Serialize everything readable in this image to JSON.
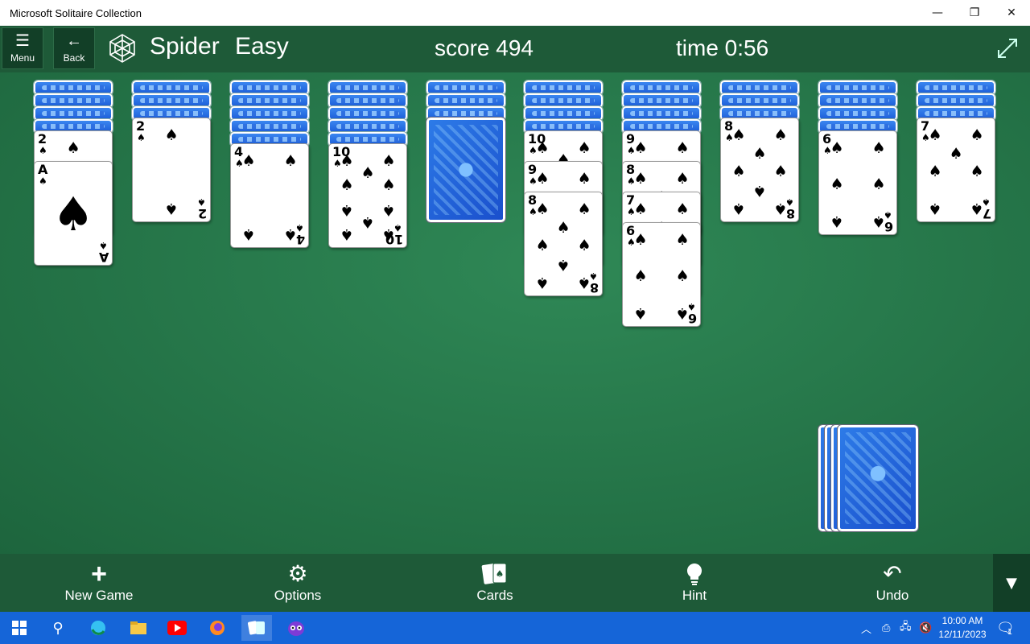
{
  "window": {
    "title": "Microsoft Solitaire Collection",
    "minimize": "—",
    "restore": "❐",
    "close": "✕"
  },
  "header": {
    "menu_label": "Menu",
    "back_label": "Back",
    "game_name": "Spider",
    "game_level": "Easy",
    "score_text": "score  494",
    "time_text": "time  0:56"
  },
  "tableau": [
    {
      "face_down": 4,
      "face_up": [
        {
          "rank": "2",
          "suit": "♠"
        },
        {
          "rank": "A",
          "suit": "♠"
        }
      ]
    },
    {
      "face_down": 3,
      "face_up": [
        {
          "rank": "2",
          "suit": "♠"
        }
      ]
    },
    {
      "face_down": 5,
      "face_up": [
        {
          "rank": "4",
          "suit": "♠"
        }
      ]
    },
    {
      "face_down": 5,
      "face_up": [
        {
          "rank": "10",
          "suit": "♠"
        }
      ]
    },
    {
      "face_down": 3,
      "face_up": [],
      "full_back": true
    },
    {
      "face_down": 4,
      "face_up": [
        {
          "rank": "10",
          "suit": "♠"
        },
        {
          "rank": "9",
          "suit": "♠"
        },
        {
          "rank": "8",
          "suit": "♠"
        }
      ]
    },
    {
      "face_down": 4,
      "face_up": [
        {
          "rank": "9",
          "suit": "♠"
        },
        {
          "rank": "8",
          "suit": "♠"
        },
        {
          "rank": "7",
          "suit": "♠"
        },
        {
          "rank": "6",
          "suit": "♠"
        }
      ]
    },
    {
      "face_down": 3,
      "face_up": [
        {
          "rank": "8",
          "suit": "♠"
        }
      ]
    },
    {
      "face_down": 4,
      "face_up": [
        {
          "rank": "6",
          "suit": "♠"
        }
      ]
    },
    {
      "face_down": 3,
      "face_up": [
        {
          "rank": "7",
          "suit": "♠"
        }
      ]
    }
  ],
  "stock": {
    "piles_remaining": 4
  },
  "toolbar": {
    "new_game": "New Game",
    "options": "Options",
    "cards": "Cards",
    "hint": "Hint",
    "undo": "Undo"
  },
  "taskbar": {
    "time": "10:00 AM",
    "date": "12/11/2023",
    "notification_count": "1"
  },
  "colors": {
    "felt": "#2a7a4c",
    "bar": "#1e5a38",
    "taskbar": "#1565d8",
    "card_back": "#2d7be8"
  }
}
